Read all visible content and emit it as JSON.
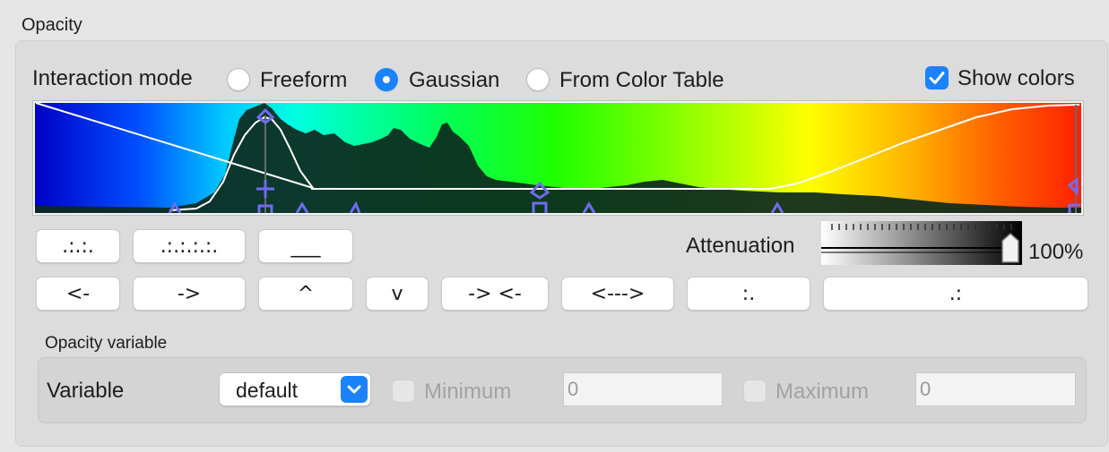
{
  "group": {
    "title": "Opacity"
  },
  "interaction": {
    "label": "Interaction mode",
    "modes": [
      {
        "label": "Freeform",
        "selected": false
      },
      {
        "label": "Gaussian",
        "selected": true
      },
      {
        "label": "From Color Table",
        "selected": false
      }
    ],
    "show_colors": {
      "label": "Show colors",
      "checked": true
    }
  },
  "transfer_function": {
    "colormap": [
      "#0000c8",
      "#0050ff",
      "#00c8ff",
      "#00ffe0",
      "#00ff60",
      "#20ff00",
      "#a0ff00",
      "#ffff00",
      "#ffb000",
      "#ff6000",
      "#ff2000"
    ],
    "white_curve_color": "#ffffff",
    "histogram_color": "#0d2a1e",
    "control_point_color": "#6f6cf0"
  },
  "buttons_row1": [
    {
      "label": ".:.:."
    },
    {
      "label": ".:.:.:.:."
    },
    {
      "label": "___"
    }
  ],
  "attenuation": {
    "label": "Attenuation",
    "value": "100%"
  },
  "buttons_row2": [
    {
      "label": "<-"
    },
    {
      "label": "->"
    },
    {
      "label": "^"
    },
    {
      "label": "v"
    },
    {
      "label": "-> <-"
    },
    {
      "label": "<--->"
    },
    {
      "label": ":."
    },
    {
      "label": ".:"
    }
  ],
  "opacity_variable": {
    "title": "Opacity variable",
    "variable_label": "Variable",
    "variable_value": "default",
    "minimum": {
      "label": "Minimum",
      "value": "0",
      "enabled": false
    },
    "maximum": {
      "label": "Maximum",
      "value": "0",
      "enabled": false
    }
  }
}
